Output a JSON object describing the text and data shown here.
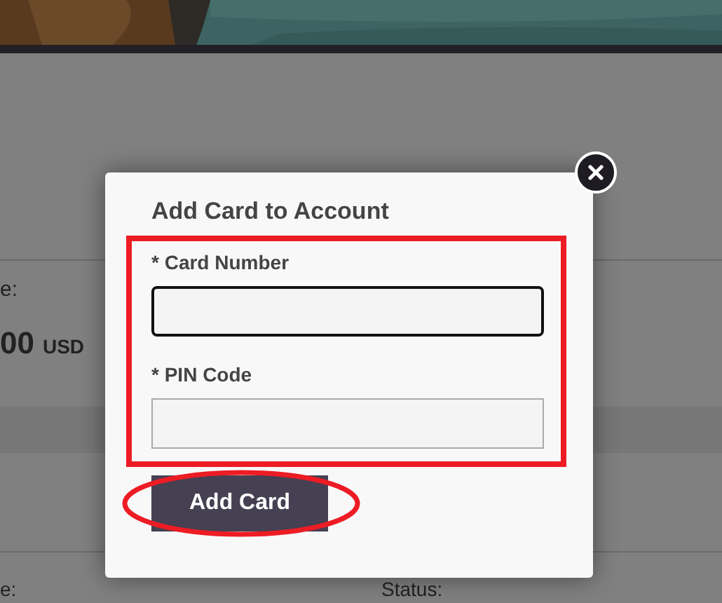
{
  "background": {
    "balance_label": "e:",
    "balance_amount": "00",
    "balance_currency": "USD",
    "row_label": "e:",
    "status_label": "Status:"
  },
  "dialog": {
    "title": "Add Card to Account",
    "fields": [
      {
        "label": "* Card Number",
        "focused": true
      },
      {
        "label": "* PIN Code",
        "focused": false
      }
    ],
    "submit": "Add Card"
  },
  "annotations": [
    {
      "kind": "rectangle"
    },
    {
      "kind": "ellipse"
    }
  ]
}
